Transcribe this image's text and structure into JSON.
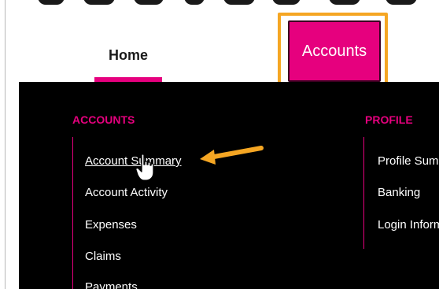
{
  "nav": {
    "home_label": "Home",
    "accounts_label": "Accounts"
  },
  "menu": {
    "accounts_section": {
      "title": "ACCOUNTS",
      "items": [
        "Account Summary",
        "Account Activity",
        "Expenses",
        "Claims",
        "Payments"
      ]
    },
    "profile_section": {
      "title": "PROFILE",
      "items": [
        "Profile Summary",
        "Banking",
        "Login Information"
      ]
    }
  },
  "colors": {
    "brand": "#e6007e",
    "highlight": "#f5a623",
    "menu_bg": "#000000"
  },
  "icons": {
    "pointer": "hand-pointer-icon",
    "arrow": "arrow-left-icon"
  }
}
